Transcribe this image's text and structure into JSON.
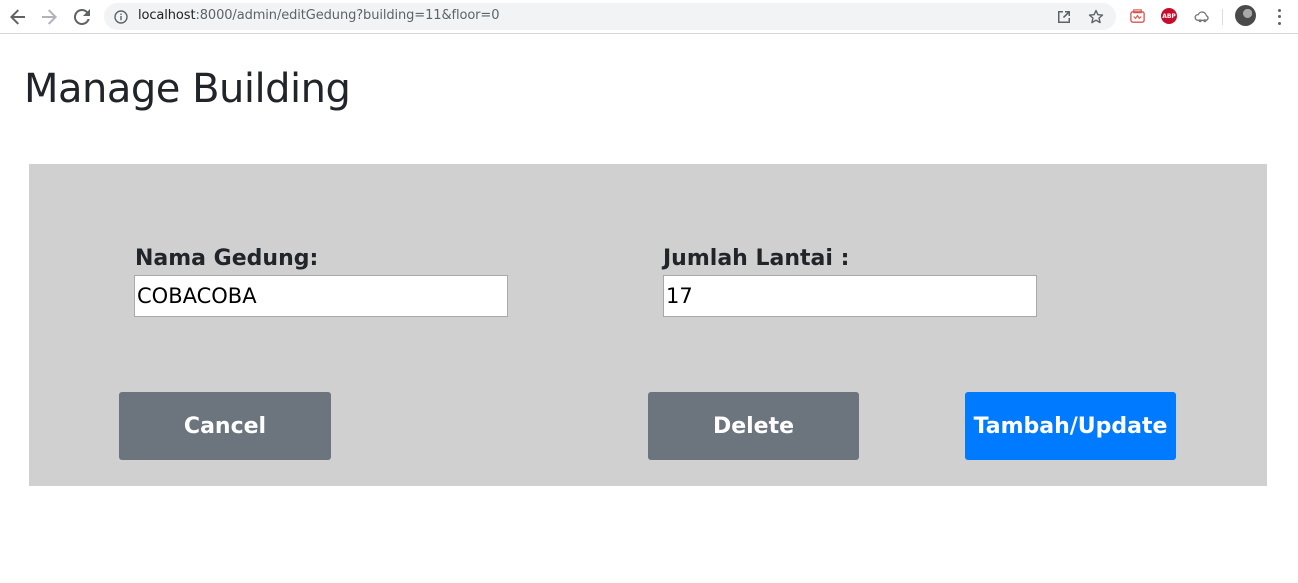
{
  "browser": {
    "url_host": "localhost",
    "url_rest": ":8000/admin/editGedung?building=11&floor=0",
    "abp_label": "ABP",
    "icons": [
      "back-arrow-icon",
      "forward-arrow-icon",
      "reload-icon",
      "info-icon",
      "open-in-new-icon",
      "star-icon",
      "extension-icon",
      "abp-icon",
      "cloud-extension-icon",
      "avatar",
      "more-vert-icon"
    ]
  },
  "page": {
    "title": "Manage Building"
  },
  "form": {
    "name_label": "Nama Gedung:",
    "name_value": "COBACOBA",
    "floors_label": "Jumlah Lantai :",
    "floors_value": "17"
  },
  "actions": {
    "cancel": "Cancel",
    "delete": "Delete",
    "submit": "Tambah/Update"
  },
  "colors": {
    "panel_bg": "#d0d0d0",
    "secondary_btn": "#6c757d",
    "primary_btn": "#007bff"
  }
}
